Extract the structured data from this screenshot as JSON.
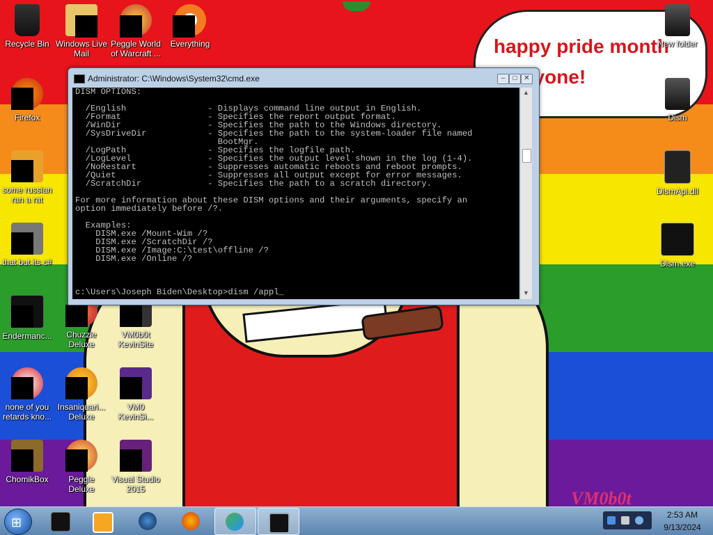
{
  "wallpaper": {
    "bubble_line1": "happy pride month",
    "bubble_line2": "everyone!",
    "signature": "VM0b0t"
  },
  "desktop_icons_left": [
    {
      "label": "Recycle Bin",
      "icon": "recycle-bin-icon"
    },
    {
      "label": "Windows Live Mail",
      "icon": "mail-icon"
    },
    {
      "label": "Peggle World of Warcraft ...",
      "icon": "peggle-icon"
    },
    {
      "label": "Everything",
      "icon": "search-icon"
    },
    {
      "label": "Firefox",
      "icon": "firefox-icon"
    },
    {
      "label": "some russian ran a rat",
      "icon": "app-icon"
    },
    {
      "label": "that but its c#",
      "icon": "stack-icon"
    },
    {
      "label": "Endermanc...",
      "icon": "terminal-icon"
    },
    {
      "label": "Chuzzle Deluxe",
      "icon": "chuzzle-icon"
    },
    {
      "label": "VM0b0t KevinSite",
      "icon": "app-icon"
    },
    {
      "label": "none of you retards kno...",
      "icon": "app-icon"
    },
    {
      "label": "Insaniquari... Deluxe",
      "icon": "fish-icon"
    },
    {
      "label": "VM0 KevinSi...",
      "icon": "app-icon"
    },
    {
      "label": "ChomikBox",
      "icon": "chomik-icon"
    },
    {
      "label": "Peggle Deluxe",
      "icon": "peggle-icon"
    },
    {
      "label": "Visual Studio 2015",
      "icon": "visual-studio-icon"
    }
  ],
  "desktop_icons_right": [
    {
      "label": "New folder",
      "icon": "folder-icon"
    },
    {
      "label": "Dism",
      "icon": "folder-icon"
    },
    {
      "label": "DismApi.dll",
      "icon": "dll-icon"
    },
    {
      "label": "Dism.exe",
      "icon": "exe-icon"
    }
  ],
  "cmd": {
    "title": "Administrator: C:\\Windows\\System32\\cmd.exe",
    "output": "DISM OPTIONS:\n\n  /English                - Displays command line output in English.\n  /Format                 - Specifies the report output format.\n  /WinDir                 - Specifies the path to the Windows directory.\n  /SysDriveDir            - Specifies the path to the system-loader file named\n                            BootMgr.\n  /LogPath                - Specifies the logfile path.\n  /LogLevel               - Specifies the output level shown in the log (1-4).\n  /NoRestart              - Suppresses automatic reboots and reboot prompts.\n  /Quiet                  - Suppresses all output except for error messages.\n  /ScratchDir             - Specifies the path to a scratch directory.\n\nFor more information about these DISM options and their arguments, specify an\noption immediately before /?.\n\n  Examples:\n    DISM.exe /Mount-Wim /?\n    DISM.exe /ScratchDir /?\n    DISM.exe /Image:C:\\test\\offline /?\n    DISM.exe /Online /?\n\n\n\nc:\\Users\\Joseph Biden\\Desktop>dism /appl_",
    "minimize": "–",
    "maximize": "□",
    "close": "✕"
  },
  "taskbar": {
    "start_glyph": "⊞",
    "time": "2:53 AM",
    "date": "9/13/2024",
    "items": [
      "cmd-shortcut-icon",
      "media-player-icon",
      "globe-icon",
      "firefox-icon",
      "messenger-icon",
      "cmd-window-icon"
    ]
  }
}
